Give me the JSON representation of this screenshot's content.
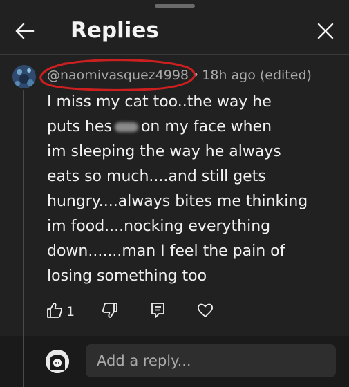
{
  "header": {
    "title": "Replies"
  },
  "comment": {
    "username": "@naomivasquez4998",
    "separator": "•",
    "time": "18h ago (edited)",
    "lines": [
      "I miss my cat too..the way he",
      "puts hes",
      "on my face when",
      "im sleeping the way he always",
      "eats so much....and still gets",
      "hungry....always bites me thinking",
      "im food....nocking everything",
      "down.......man I feel the pain of",
      "losing something too"
    ],
    "like_count": "1"
  },
  "reply_box": {
    "placeholder": "Add a reply..."
  },
  "colors": {
    "annotation": "#cc1f1f",
    "background": "#212121"
  },
  "icons": [
    "back-arrow-icon",
    "close-icon",
    "thumbs-up-icon",
    "thumbs-down-icon",
    "reply-comment-icon",
    "heart-icon"
  ]
}
